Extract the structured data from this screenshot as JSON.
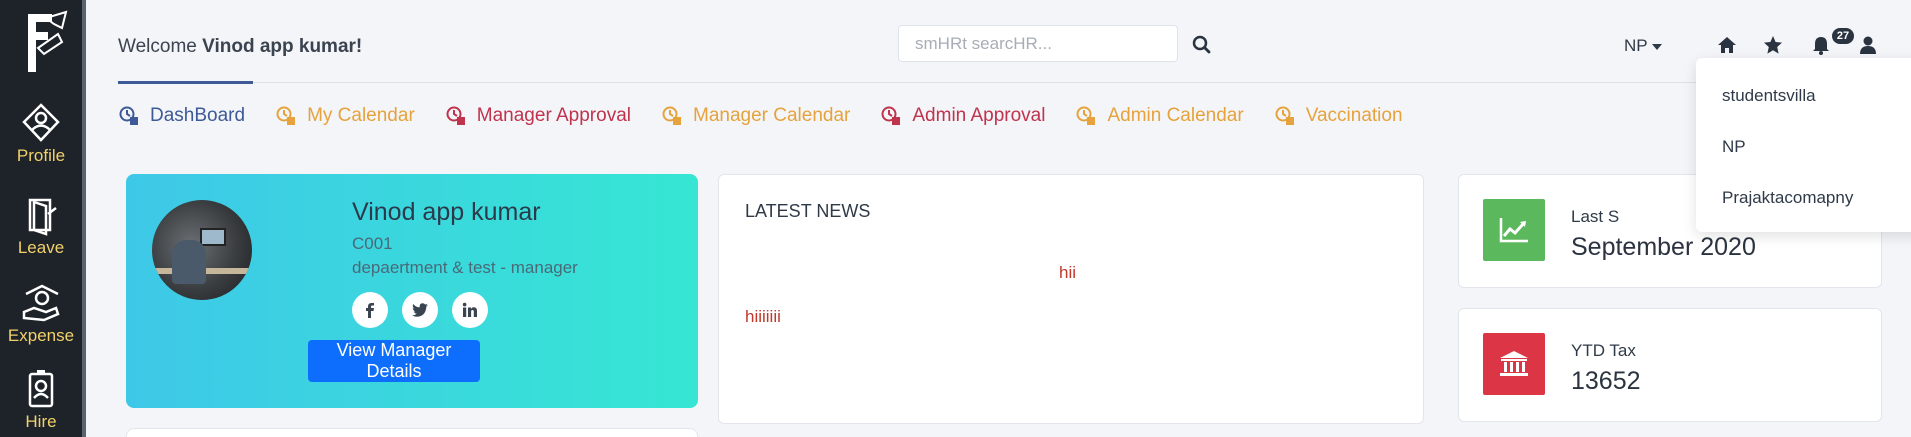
{
  "colors": {
    "sidebar_bg": "#1e2329",
    "sidebar_label": "#f2d16b",
    "tab_blue": "#3d5a97",
    "tab_orange": "#e6a23c",
    "tab_red": "#c0334d",
    "card_gradient_start": "#3ec8e8",
    "card_gradient_end": "#36e6d3",
    "primary_button": "#0d6efd",
    "news_text_red": "#c0392b",
    "stat_green": "#5cb85c",
    "stat_red": "#dc3545"
  },
  "sidebar": {
    "items": [
      {
        "label": "Profile",
        "icon": "profile-badge-icon"
      },
      {
        "label": "Leave",
        "icon": "leave-door-icon"
      },
      {
        "label": "Expense",
        "icon": "expense-hand-icon"
      },
      {
        "label": "Hire",
        "icon": "hire-badge-icon"
      }
    ]
  },
  "header": {
    "welcome_prefix": "Welcome",
    "user_name": "Vinod app kumar!",
    "search_placeholder": "smHRt searcHR...",
    "company": "NP",
    "notification_count": "27"
  },
  "tabs": [
    {
      "label": "DashBoard",
      "color": "#3d5a97",
      "active": true
    },
    {
      "label": "My Calendar",
      "color": "#e6a23c"
    },
    {
      "label": "Manager Approval",
      "color": "#c0334d"
    },
    {
      "label": "Manager Calendar",
      "color": "#e6a23c"
    },
    {
      "label": "Admin Approval",
      "color": "#c0334d"
    },
    {
      "label": "Admin Calendar",
      "color": "#e6a23c"
    },
    {
      "label": "Vaccination",
      "color": "#e6a23c"
    }
  ],
  "profile": {
    "name": "Vinod app kumar",
    "code": "C001",
    "department": "depaertment & test - manager",
    "socials": [
      "f",
      "t",
      "in"
    ],
    "button_label": "View Manager Details"
  },
  "news": {
    "title": "LATEST NEWS",
    "items": [
      "hii",
      "hiiiiiii"
    ]
  },
  "stats": [
    {
      "label": "Last S",
      "value": "September 2020",
      "icon": "line-chart-icon"
    },
    {
      "label": "YTD Tax",
      "value": "13652",
      "icon": "bank-icon"
    }
  ],
  "dropdown": {
    "items": [
      "studentsvilla",
      "NP",
      "Prajaktacomapny"
    ]
  }
}
